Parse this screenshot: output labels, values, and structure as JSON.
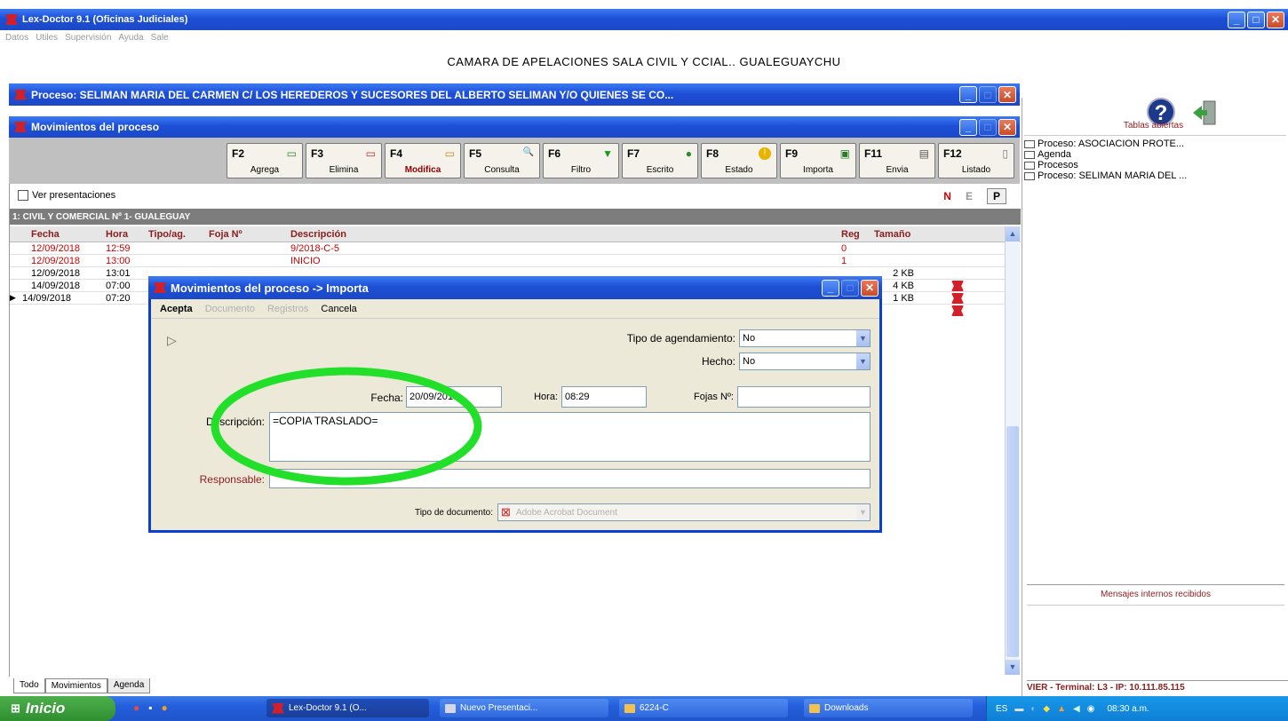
{
  "app": {
    "title": "Lex-Doctor 9.1 (Oficinas Judiciales)",
    "menu": [
      "Datos",
      "Utiles",
      "Supervisión",
      "Ayuda",
      "Sale"
    ],
    "court_header": "CAMARA DE APELACIONES SALA CIVIL Y CCIAL.. GUALEGUAYCHU"
  },
  "proceso_window": {
    "title": "Proceso: SELIMAN MARIA DEL CARMEN C/ LOS HEREDEROS Y SUCESORES DEL ALBERTO SELIMAN Y/O QUIENES SE CO..."
  },
  "movimientos_window": {
    "title": "Movimientos del proceso",
    "fkeys": [
      {
        "key": "F2",
        "label": "Agrega",
        "icon": "add-doc-icon",
        "glyph": "▭"
      },
      {
        "key": "F3",
        "label": "Elimina",
        "icon": "delete-doc-icon",
        "glyph": "▭"
      },
      {
        "key": "F4",
        "label": "Modifica",
        "icon": "edit-doc-icon",
        "glyph": "▭"
      },
      {
        "key": "F5",
        "label": "Consulta",
        "icon": "magnifier-icon",
        "glyph": "🔍"
      },
      {
        "key": "F6",
        "label": "Filtro",
        "icon": "filter-icon",
        "glyph": "▼"
      },
      {
        "key": "F7",
        "label": "Escrito",
        "icon": "document-icon",
        "glyph": "●"
      },
      {
        "key": "F8",
        "label": "Estado",
        "icon": "warning-icon",
        "glyph": "!"
      },
      {
        "key": "F9",
        "label": "Importa",
        "icon": "import-icon",
        "glyph": "▣"
      },
      {
        "key": "F11",
        "label": "Envia",
        "icon": "send-icon",
        "glyph": "▤"
      },
      {
        "key": "F12",
        "label": "Listado",
        "icon": "list-icon",
        "glyph": "▯"
      }
    ],
    "ver_presentaciones": "Ver presentaciones",
    "nep": [
      "N",
      "E",
      "P"
    ],
    "section_title": "1: CIVIL Y COMERCIAL Nº 1- GUALEGUAY",
    "columns": [
      "Fecha",
      "Hora",
      "Tipo/ag.",
      "Foja Nº",
      "Descripción",
      "Reg",
      "Tamaño"
    ],
    "rows": [
      {
        "fecha": "12/09/2018",
        "hora": "12:59",
        "tipo": "",
        "foja": "",
        "desc": "9/2018-C-5",
        "reg": "0",
        "size": "",
        "red": true
      },
      {
        "fecha": "12/09/2018",
        "hora": "13:00",
        "tipo": "",
        "foja": "",
        "desc": "INICIO",
        "reg": "1",
        "size": "",
        "red": true
      },
      {
        "fecha": "12/09/2018",
        "hora": "13:01",
        "tipo": "",
        "foja": "",
        "desc": "",
        "reg": "",
        "size": "2 KB",
        "red": false
      },
      {
        "fecha": "14/09/2018",
        "hora": "07:00",
        "tipo": "",
        "foja": "",
        "desc": "",
        "reg": "",
        "size": "4 KB",
        "red": false
      },
      {
        "fecha": "14/09/2018",
        "hora": "07:20",
        "tipo": "",
        "foja": "",
        "desc": "",
        "reg": "",
        "size": "1 KB",
        "red": false
      }
    ],
    "tabs": [
      "Todo",
      "Movimientos",
      "Agenda"
    ]
  },
  "dialog": {
    "title": "Movimientos del proceso -> Importa",
    "menu": [
      "Acepta",
      "Documento",
      "Registros",
      "Cancela"
    ],
    "tipo_agendamiento_label": "Tipo de agendamiento:",
    "tipo_agendamiento_value": "No",
    "hecho_label": "Hecho:",
    "hecho_value": "No",
    "fecha_label": "Fecha:",
    "fecha_value": "20/09/2018",
    "hora_label": "Hora:",
    "hora_value": "08:29",
    "fojas_label": "Fojas Nº:",
    "fojas_value": "",
    "descripcion_label": "Descripción:",
    "descripcion_value": "=COPIA TRASLADO=",
    "responsable_label": "Responsable:",
    "responsable_value": "",
    "tipo_documento_label": "Tipo de documento:",
    "tipo_documento_value": "Adobe Acrobat Document"
  },
  "right_panel": {
    "tablas_title": "Tablas abiertas",
    "tablas_items": [
      "Proceso: ASOCIACION PROTE...",
      "Agenda",
      "Procesos",
      "Proceso: SELIMAN MARIA DEL ..."
    ],
    "mensajes_title": "Mensajes internos recibidos",
    "status": "VIER - Terminal: L3 - IP: 10.111.85.115"
  },
  "taskbar": {
    "start": "Inicio",
    "items": [
      "Lex-Doctor 9.1 (O...",
      "Nuevo Presentaci...",
      "6224-C",
      "Downloads"
    ],
    "lang": "ES",
    "clock": "08:30 a.m."
  },
  "colors": {
    "xp_blue": "#2a5ee0",
    "annotation": "#22e02a",
    "red_text": "#d00000"
  }
}
